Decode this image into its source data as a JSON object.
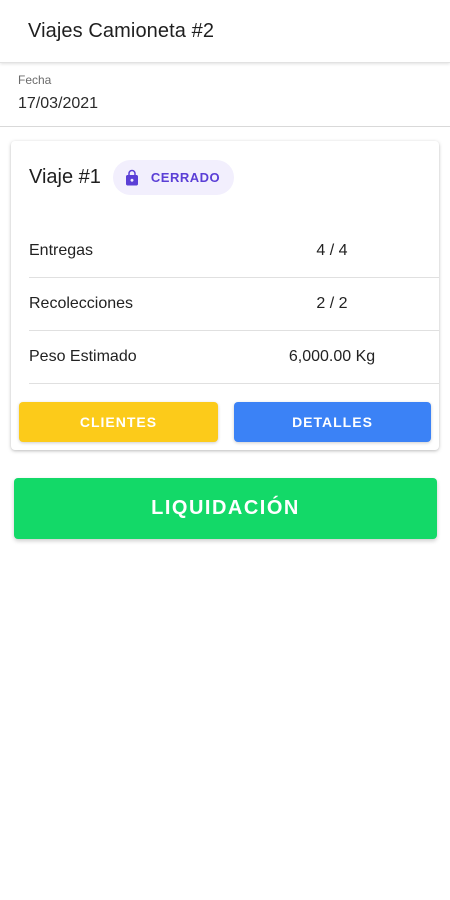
{
  "header": {
    "title": "Viajes Camioneta #2"
  },
  "date_field": {
    "label": "Fecha",
    "value": "17/03/2021"
  },
  "trip_card": {
    "title": "Viaje #1",
    "status": {
      "icon": "lock-icon",
      "label": "CERRADO",
      "color": "#5b3fd6"
    },
    "rows": [
      {
        "label": "Entregas",
        "value": "4 / 4"
      },
      {
        "label": "Recolecciones",
        "value": "2 / 2"
      },
      {
        "label": "Peso Estimado",
        "value": "6,000.00 Kg"
      }
    ],
    "buttons": {
      "clientes": {
        "label": "CLIENTES",
        "color": "#fccb1a"
      },
      "detalles": {
        "label": "DETALLES",
        "color": "#3b82f6"
      }
    }
  },
  "liquidacion_button": {
    "label": "LIQUIDACIÓN",
    "color": "#13d968"
  }
}
